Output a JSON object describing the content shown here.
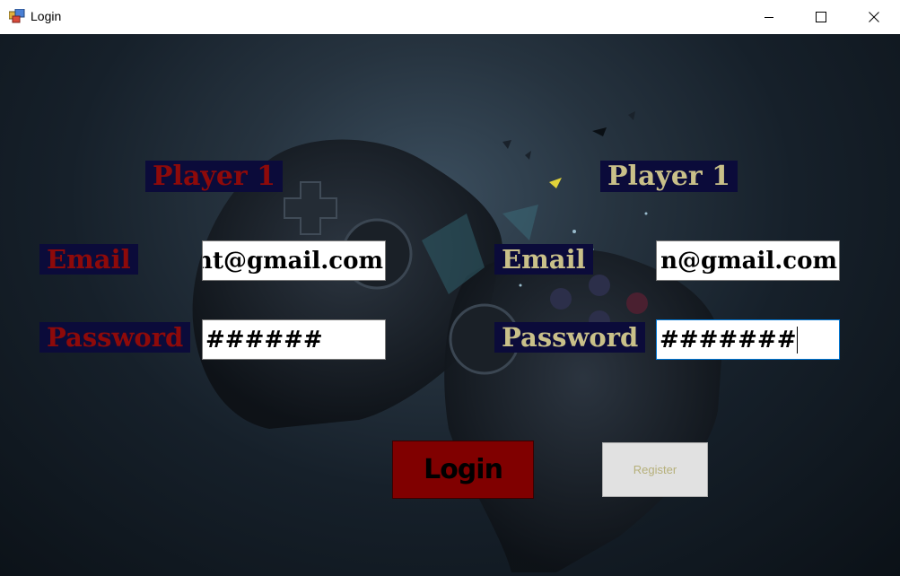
{
  "window": {
    "title": "Login",
    "icon": "winforms-app-icon",
    "controls": [
      "minimize-icon",
      "maximize-icon",
      "close-icon"
    ]
  },
  "player_left": {
    "heading": "Player 1",
    "email_label": "Email",
    "email_value": "nt@gmail.com",
    "password_label": "Password",
    "password_value": "######"
  },
  "player_right": {
    "heading": "Player 1",
    "email_label": "Email",
    "email_value": "n@gmail.com",
    "password_label": "Password",
    "password_value": "#######"
  },
  "buttons": {
    "login_label": "Login",
    "register_label": "Register"
  },
  "colors": {
    "player_left_text": "#8e0a0a",
    "player_right_text": "#c9c089",
    "label_bg": "#0b0b3a",
    "login_bg": "#800000",
    "register_bg": "#e1e1e1",
    "register_text": "#b6b07a"
  }
}
